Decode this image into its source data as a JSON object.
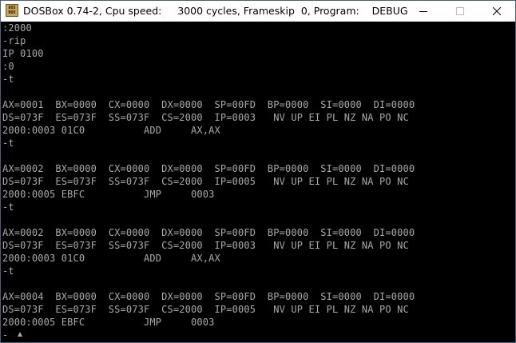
{
  "window": {
    "title": "DOSBox 0.74-2, Cpu speed:     3000 cycles, Frameskip  0, Program:    DEBUG",
    "icon_text_top": "DOS",
    "icon_text_bottom": "BOX",
    "buttons": [
      "minimize-icon",
      "maximize-icon",
      "close-icon"
    ]
  },
  "console": {
    "lines": [
      ":2000",
      "-rip",
      "IP 0100",
      ":0",
      "-t",
      "",
      "AX=0001  BX=0000  CX=0000  DX=0000  SP=00FD  BP=0000  SI=0000  DI=0000",
      "DS=073F  ES=073F  SS=073F  CS=2000  IP=0003   NV UP EI PL NZ NA PO NC",
      "2000:0003 01C0          ADD     AX,AX",
      "-t",
      "",
      "AX=0002  BX=0000  CX=0000  DX=0000  SP=00FD  BP=0000  SI=0000  DI=0000",
      "DS=073F  ES=073F  SS=073F  CS=2000  IP=0005   NV UP EI PL NZ NA PO NC",
      "2000:0005 EBFC          JMP     0003",
      "-t",
      "",
      "AX=0002  BX=0000  CX=0000  DX=0000  SP=00FD  BP=0000  SI=0000  DI=0000",
      "DS=073F  ES=073F  SS=073F  CS=2000  IP=0003   NV UP EI PL NZ NA PO NC",
      "2000:0003 01C0          ADD     AX,AX",
      "-t",
      "",
      "AX=0004  BX=0000  CX=0000  DX=0000  SP=00FD  BP=0000  SI=0000  DI=0000",
      "DS=073F  ES=073F  SS=073F  CS=2000  IP=0005   NV UP EI PL NZ NA PO NC",
      "2000:0005 EBFC          JMP     0003",
      "-"
    ],
    "text_color": "#aaaaaa",
    "background": "#000000"
  }
}
